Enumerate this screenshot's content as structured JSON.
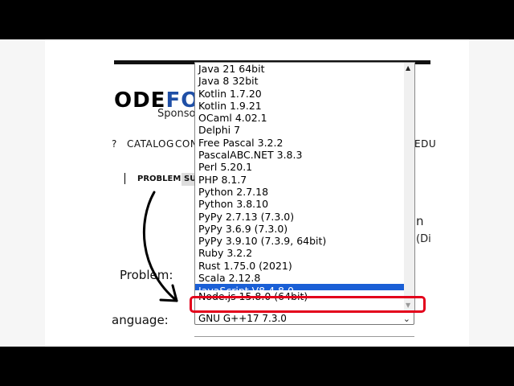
{
  "logo": {
    "prefix": "ODE",
    "accent": "FOR",
    "tagline": "Sponso"
  },
  "nav": {
    "items": [
      "CATALOG",
      "CONT",
      "EDU"
    ]
  },
  "subnav": {
    "problems": "PROBLEMS",
    "submit": "SU"
  },
  "sidebar_text": {
    "line1": "n",
    "line2": "(Di"
  },
  "form": {
    "problem_label": "Problem:",
    "language_label": "anguage:",
    "language_value": "GNU G++17 7.3.0"
  },
  "dropdown": {
    "options": [
      "Java 21 64bit",
      "Java 8 32bit",
      "Kotlin 1.7.20",
      "Kotlin 1.9.21",
      "OCaml 4.02.1",
      "Delphi 7",
      "Free Pascal 3.2.2",
      "PascalABC.NET 3.8.3",
      "Perl 5.20.1",
      "PHP 8.1.7",
      "Python 2.7.18",
      "Python 3.8.10",
      "PyPy 2.7.13 (7.3.0)",
      "PyPy 3.6.9 (7.3.0)",
      "PyPy 3.9.10 (7.3.9, 64bit)",
      "Ruby 3.2.2",
      "Rust 1.75.0 (2021)",
      "Scala 2.12.8",
      "JavaScript V8 4.8.0",
      "Node.js 15.8.0 (64bit)"
    ],
    "selected_index": 18,
    "highlighted_index": 19
  },
  "colors": {
    "accent": "#1f4fa6",
    "selection": "#1a5fd6",
    "highlight_border": "#e3001b"
  },
  "icons": {
    "arrow": "curved-arrow-annotation",
    "scroll_up": "scroll-up-icon",
    "scroll_down": "scroll-down-icon",
    "select_chevron": "chevron-down-icon"
  }
}
